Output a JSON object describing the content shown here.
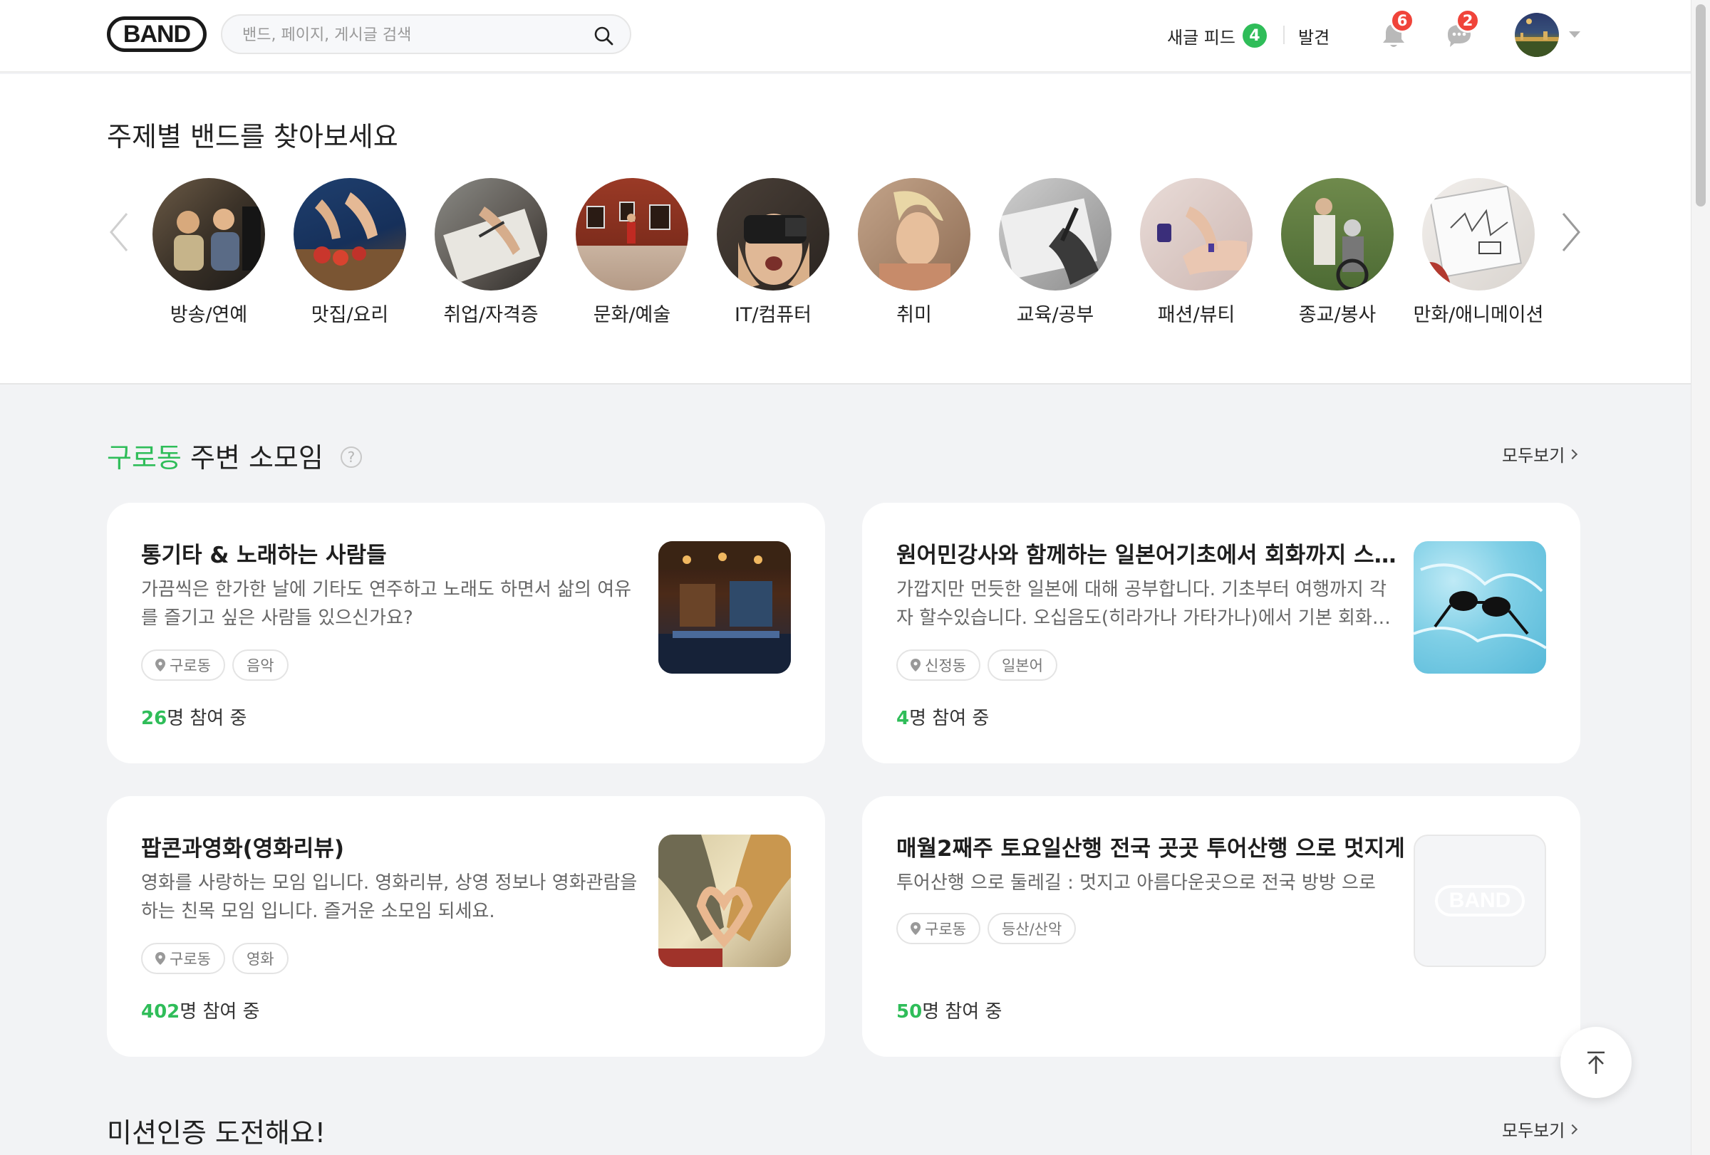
{
  "header": {
    "logo": "BAND",
    "search_placeholder": "밴드, 페이지, 게시글 검색",
    "new_feed_label": "새글 피드",
    "new_feed_count": "4",
    "discover_label": "발견",
    "notifications_badge": "6",
    "chat_badge": "2"
  },
  "topics": {
    "title": "주제별 밴드를 찾아보세요",
    "items": [
      {
        "label": "방송/연예"
      },
      {
        "label": "맛집/요리"
      },
      {
        "label": "취업/자격증"
      },
      {
        "label": "문화/예술"
      },
      {
        "label": "IT/컴퓨터"
      },
      {
        "label": "취미"
      },
      {
        "label": "교육/공부"
      },
      {
        "label": "패션/뷰티"
      },
      {
        "label": "종교/봉사"
      },
      {
        "label": "만화/애니메이션"
      }
    ]
  },
  "nearby": {
    "location": "구로동",
    "title_suffix": " 주변 소모임",
    "help": "?",
    "see_all": "모두보기",
    "cards": [
      {
        "title": "통기타 & 노래하는 사람들",
        "desc": "가끔씩은 한가한 날에 기타도 연주하고 노래도 하면서 삶의 여유를 즐기고 싶은 사람들 있으신가요?",
        "tags": [
          "구로동",
          "음악"
        ],
        "count": "26",
        "count_suffix": "명 참여 중"
      },
      {
        "title": "원어민강사와 함께하는 일본어기초에서 회화까지 스터디",
        "desc": "가깝지만 먼듯한 일본에 대해 공부합니다. 기초부터 여행까지 각자 할수있습니다. 오십음도(히라가나 가타가나)에서 기본 회화…",
        "tags": [
          "신정동",
          "일본어"
        ],
        "count": "4",
        "count_suffix": "명 참여 중"
      },
      {
        "title": "팝콘과영화(영화리뷰)",
        "desc": "영화를 사랑하는 모임 입니다. 영화리뷰, 상영 정보나 영화관람을 하는 친목 모임 입니다. 즐거운 소모임 되세요.",
        "tags": [
          "구로동",
          "영화"
        ],
        "count": "402",
        "count_suffix": "명 참여 중"
      },
      {
        "title": "매월2째주 토요일산행 전국 곳곳 투어산행 으로 멋지게",
        "desc": "투어산행 으로 둘레길  : 멋지고 아름다운곳으로 전국 방방 으로",
        "tags": [
          "구로동",
          "등산/산악"
        ],
        "count": "50",
        "count_suffix": "명 참여 중",
        "placeholder_logo": "BAND"
      }
    ]
  },
  "mission": {
    "title": "미션인증 도전해요!",
    "see_all": "모두보기"
  },
  "colors": {
    "accent_green": "#2fbd59",
    "badge_red": "#f0443a"
  }
}
